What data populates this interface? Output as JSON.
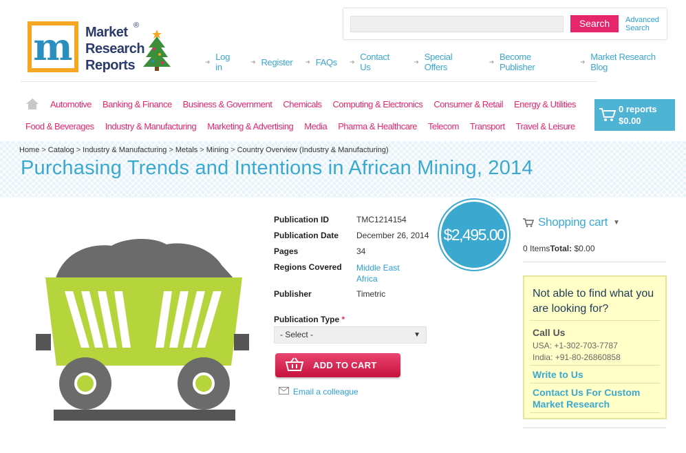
{
  "logo": {
    "line1": "Market",
    "line2": "Research",
    "line3": "Reports",
    "mark": "m",
    "reg": "®"
  },
  "search": {
    "button": "Search",
    "advanced_line1": "Advanced",
    "advanced_line2": "Search",
    "placeholder": ""
  },
  "toplinks": [
    "Log in",
    "Register",
    "FAQs",
    "Contact Us",
    "Special Offers",
    "Become Publisher",
    "Market Research Blog"
  ],
  "categories_row1": [
    "Automotive",
    "Banking & Finance",
    "Business & Government",
    "Chemicals",
    "Computing & Electronics",
    "Consumer & Retail",
    "Energy & Utilities"
  ],
  "categories_row2": [
    "Food & Beverages",
    "Industry & Manufacturing",
    "Marketing & Advertising",
    "Media",
    "Pharma & Healthcare",
    "Telecom",
    "Transport",
    "Travel & Leisure"
  ],
  "mini_cart": {
    "reports": "0 reports",
    "total": "$0.00"
  },
  "breadcrumb": [
    "Home",
    "Catalog",
    "Industry & Manufacturing",
    "Metals",
    "Mining",
    "Country Overview (Industry & Manufacturing)"
  ],
  "page_title": "Purchasing Trends and Intentions in African Mining, 2014",
  "product": {
    "pub_id_label": "Publication ID",
    "pub_id": "TMC1214154",
    "pub_date_label": "Publication Date",
    "pub_date": "December 26, 2014",
    "pages_label": "Pages",
    "pages": "34",
    "regions_label": "Regions Covered",
    "region1": "Middle East",
    "region2": "Africa",
    "publisher_label": "Publisher",
    "publisher": "Timetric",
    "price": "$2,495.00",
    "type_label": "Publication Type",
    "type_required": "*",
    "type_selected": "- Select -",
    "add_to_cart": "ADD TO CART",
    "email_colleague": "Email a colleague"
  },
  "sidebar": {
    "cart_title": "Shopping cart",
    "items": "0 Items",
    "total_label": "Total:",
    "total": "$0.00",
    "help_question": "Not able to find what you are looking for?",
    "call_us": "Call Us",
    "usa": "USA: +1-302-703-7787",
    "india": "India: +91-80-26860858",
    "write": "Write to Us",
    "custom": "Contact Us For Custom Market Research"
  },
  "colors": {
    "accent_pink": "#e6266b",
    "accent_blue": "#3ba9cf",
    "truck_green": "#b6d43c"
  }
}
